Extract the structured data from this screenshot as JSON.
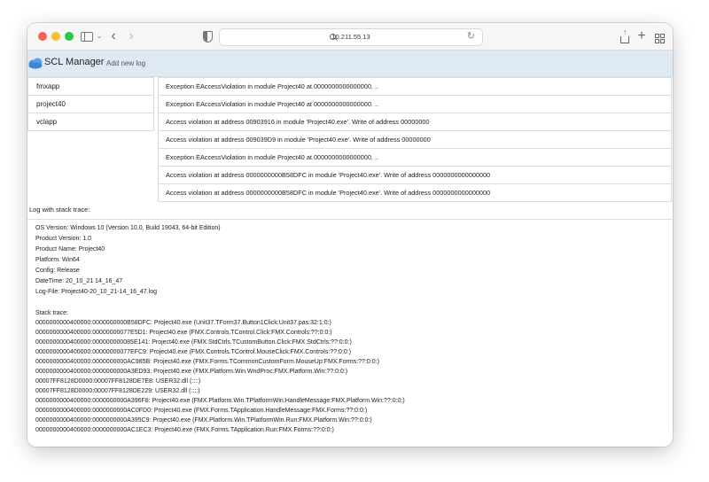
{
  "browser": {
    "url": "10.211.55.13"
  },
  "app": {
    "title": "SCL Manager",
    "add_log_label": "Add new log"
  },
  "applications": [
    "fmxapp",
    "project40",
    "vclapp"
  ],
  "logs": [
    "Exception EAccessViolation in module Project40 at 0000000000000000. ..",
    "Exception EAccessViolation in module Project40 at 0000000000000000. ..",
    "Access violation at address 00903916 in module 'Project40.exe'. Write of address 00000000",
    "Access violation at address 009039D9 in module 'Project40.exe'. Write of address 00000000",
    "Exception EAccessViolation in module Project40 at 0000000000000000. ..",
    "Access violation at address 0000000000B58DFC in module 'Project40.exe'. Write of address 0000000000000000",
    "Access violation at address 0000000000B58DFC in module 'Project40.exe'. Write of address 0000000000000000"
  ],
  "stack": {
    "label": "Log with stack trace:",
    "lines": [
      "OS Version: Windows 10 (Version 10.0, Build 19043, 64-bit Edition)",
      "Product Version: 1.0",
      "Product Name: Project40",
      "Platform: Win64",
      "Config: Release",
      "DateTime: 20_10_21 14_16_47",
      "Log-File: Project40-20_10_21-14_16_47.log",
      "",
      "Stack trace:",
      "0000000000400000:0000000000B58DFC: Project40.exe (Unit37.TForm37.Button1Click:Unit37.pas:32:1:0:)",
      "0000000000400000:00000000077E5D1: Project40.exe (FMX.Controls.TControl.Click:FMX.Controls:??:0:0:)",
      "0000000000400000:000000000085E141: Project40.exe (FMX.StdCtrls.TCustomButton.Click:FMX.StdCtrls:??:0:0:)",
      "0000000000400000:00000000077EFC9: Project40.exe (FMX.Controls.TControl.MouseClick:FMX.Controls:??:0:0:)",
      "0000000000400000:0000000000AC985B: Project40.exe (FMX.Forms.TCommonCustomForm.MouseUp:FMX.Forms:??:0:0:)",
      "0000000000400000:0000000000A3ED93: Project40.exe (FMX.Platform.Win.WndProc:FMX.Platform.Win:??:0:0:)",
      "00007FF8128D0000:00007FF8128DE7E8: USER32.dll (::::)",
      "00007FF8128D0000:00007FF8128DE229: USER32.dll (::::)",
      "0000000000400000:0000000000A396F8: Project40.exe (FMX.Platform.Win.TPlatformWin.HandleMessage:FMX.Platform.Win:??:0:0:)",
      "0000000000400000:0000000000AC0FD0: Project40.exe (FMX.Forms.TApplication.HandleMessage:FMX.Forms:??:0:0:)",
      "0000000000400000:0000000000A395C9: Project40.exe (FMX.Platform.Win.TPlatformWin.Run:FMX.Platform.Win:??:0:0:)",
      "0000000000400000:0000000000AC1EC3: Project40.exe (FMX.Forms.TApplication.Run:FMX.Forms:??:0:0:)"
    ]
  },
  "colors": {
    "appbar_bg": "#dfe9f3",
    "cloud_blue": "#4a90d9"
  }
}
